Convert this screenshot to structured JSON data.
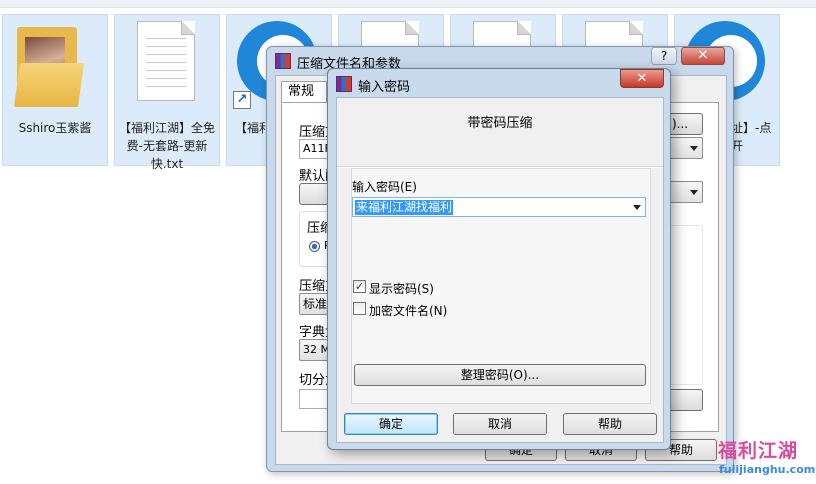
{
  "desktop": {
    "files": [
      {
        "label": "Sshiro玉紫酱"
      },
      {
        "label": "【福利江湖】全免费-无套路-更新快.txt"
      },
      {
        "label": "【福利页1】"
      },
      {
        "label": ""
      },
      {
        "label": ""
      },
      {
        "label": ""
      },
      {
        "label": "址】-点开"
      }
    ]
  },
  "back_dialog": {
    "title": "压缩文件名和参数",
    "help_label": "?",
    "close_label": "✕",
    "tab": "常规",
    "compress_file_label": "压缩文",
    "archive_name": "A11F",
    "browse_label": ")...",
    "default_label": "默认配",
    "compress_format_label": "压缩",
    "radio_label": "R",
    "method_label": "压缩方",
    "method_value": "标准",
    "dict_label": "字典大",
    "dict_value": "32 MB",
    "split_label": "切分为",
    "ok_label": "确定",
    "cancel_label": "取消",
    "help_button_label": "帮助"
  },
  "password_dialog": {
    "title": "输入密码",
    "close_label": "✕",
    "heading": "带密码压缩",
    "input_label": "输入密码(E)",
    "password_value": "来福利江湖找福利",
    "show_password": {
      "label": "显示密码(S)",
      "checked": true
    },
    "encrypt_names": {
      "label": "加密文件名(N)",
      "checked": false
    },
    "manage_label": "整理密码(O)...",
    "ok_label": "确定",
    "cancel_label": "取消",
    "help_label": "帮助"
  },
  "watermark": {
    "title": "福利江湖",
    "url": "fulijianghu.com"
  }
}
